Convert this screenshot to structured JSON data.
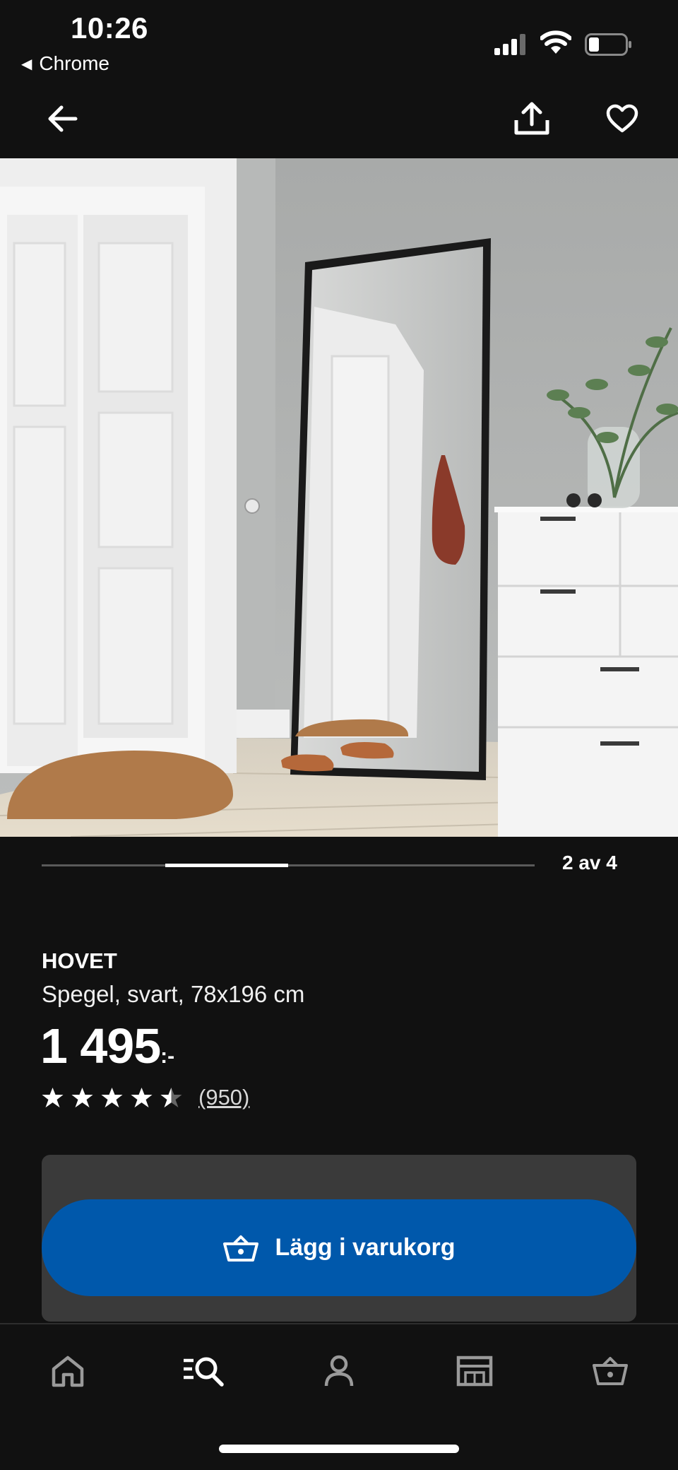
{
  "status_bar": {
    "time": "10:26",
    "back_app": "Chrome",
    "icons": [
      "signal-icon",
      "wifi-icon",
      "battery-icon"
    ]
  },
  "header": {
    "icons": [
      "arrow-left-icon",
      "share-icon",
      "heart-icon"
    ]
  },
  "carousel": {
    "counter": "2 av 4",
    "current": 2,
    "total": 4
  },
  "product": {
    "name": "HOVET",
    "description": "Spegel, svart, 78x196 cm",
    "price": "1 495",
    "price_suffix": ":-",
    "rating": 4.5,
    "rating_max": 5,
    "review_count": "(950)"
  },
  "cta": {
    "label": "Lägg i varukorg",
    "icon": "basket-icon"
  },
  "bottom_nav": {
    "items": [
      {
        "icon": "home-icon",
        "active": false
      },
      {
        "icon": "search-list-icon",
        "active": true
      },
      {
        "icon": "profile-icon",
        "active": false
      },
      {
        "icon": "store-icon",
        "active": false
      },
      {
        "icon": "basket-icon",
        "active": false
      }
    ]
  },
  "colors": {
    "background": "#111111",
    "accent": "#0058ab",
    "panel": "#3a3a3a",
    "inactive_icon": "#9a9a9a"
  }
}
